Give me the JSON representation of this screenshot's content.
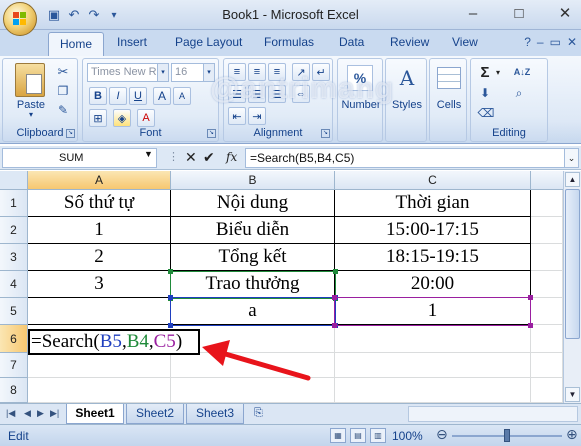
{
  "window": {
    "title": "Book1 - Microsoft Excel",
    "controls": {
      "minimize": "–",
      "maximize": "□",
      "close": "✕"
    }
  },
  "quick_access": [
    {
      "name": "save-icon",
      "glyph": "▣"
    },
    {
      "name": "undo-icon",
      "glyph": "↶"
    },
    {
      "name": "redo-icon",
      "glyph": "↷"
    },
    {
      "name": "customize-icon",
      "glyph": "▾"
    }
  ],
  "ribbon": {
    "tabs": [
      "Home",
      "Insert",
      "Page Layout",
      "Formulas",
      "Data",
      "Review",
      "View"
    ],
    "active_tab": "Home",
    "groups": {
      "clipboard": {
        "label": "Clipboard",
        "paste": "Paste"
      },
      "font": {
        "label": "Font",
        "font_name": "Times New Ro",
        "font_size": "16",
        "bold": "B",
        "italic": "I",
        "underline": "U",
        "grow": "A",
        "shrink": "A"
      },
      "alignment": {
        "label": "Alignment"
      },
      "number": {
        "label": "Number",
        "symbol": "%"
      },
      "styles": {
        "label": "Styles",
        "symbol": "A"
      },
      "cells": {
        "label": "Cells"
      },
      "editing": {
        "label": "Editing",
        "sum": "Σ",
        "sort": "A↓Z",
        "find": "A"
      }
    }
  },
  "watermark": "@antrimang",
  "formula_bar": {
    "name_box": "SUM",
    "formula": "=Search(B5,B4,C5)"
  },
  "grid": {
    "columns": [
      "A",
      "B",
      "C"
    ],
    "rows": [
      "1",
      "2",
      "3",
      "4",
      "5",
      "6",
      "7",
      "8"
    ],
    "cells": {
      "A1": "Số thứ tự",
      "B1": "Nội dung",
      "C1": "Thời gian",
      "A2": "1",
      "B2": "Biểu diễn",
      "C2": "15:00-17:15",
      "A3": "2",
      "B3": "Tổng kết",
      "C3": "18:15-19:15",
      "A4": "3",
      "B4": "Trao thưởng",
      "C4": "20:00",
      "A5": "",
      "B5": "a",
      "C5": "1"
    },
    "edit": {
      "prefix": "=Search(",
      "ref1": "B5",
      "sep1": ",",
      "ref2": "B4",
      "sep2": ",",
      "ref3": "C5",
      "suffix": ")"
    },
    "ref_colors": {
      "B5": "#1f3fbf",
      "B4": "#1f8a3a",
      "C5": "#9a1fa0"
    }
  },
  "sheets": {
    "tabs": [
      "Sheet1",
      "Sheet2",
      "Sheet3"
    ],
    "active": "Sheet1"
  },
  "status": {
    "mode": "Edit",
    "zoom": "100%"
  },
  "annotation": {
    "color": "#e8141b"
  }
}
